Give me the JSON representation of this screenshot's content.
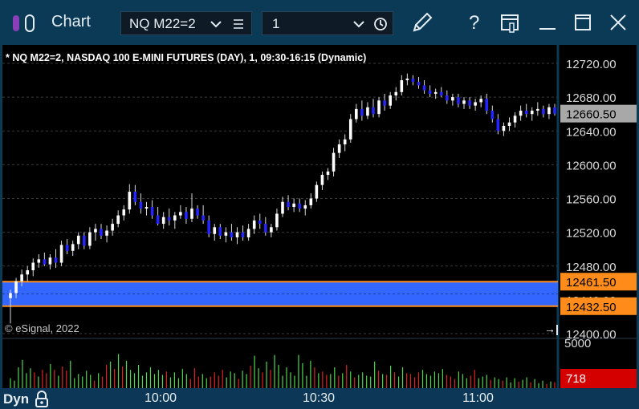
{
  "window": {
    "title": "Chart",
    "symbol": "NQ M22=2",
    "interval": "1"
  },
  "chart_data": {
    "type": "candlestick",
    "title": "* NQ M22=2, NASDAQ 100 E-MINI FUTURES (DAY), 1, 09:30-16:15 (Dynamic)",
    "watermark": "© eSignal, 2022",
    "price_axis": {
      "ticks": [
        12720.0,
        12680.0,
        12640.0,
        12600.0,
        12560.0,
        12520.0,
        12480.0,
        12440.0,
        12400.0
      ],
      "tick_labels": [
        "12720.00",
        "12680.00",
        "12640.00",
        "12600.00",
        "12560.00",
        "12520.00",
        "12480.00",
        "12440.00",
        "12400.00"
      ],
      "range": [
        12400,
        12730
      ]
    },
    "time_axis": {
      "labels": [
        "10:00",
        "10:30",
        "11:00"
      ]
    },
    "last_price": {
      "value": 12660.5,
      "label": "12660.50"
    },
    "zone": {
      "top": 12461.5,
      "top_label": "12461.50",
      "bottom": 12432.5,
      "bottom_label": "12432.50",
      "color": "#3366ff",
      "border_color": "#ff8c1a"
    },
    "volume": {
      "tick_label": "5000",
      "last_value": 718,
      "last_label": "718",
      "max": 5600,
      "values": [
        1200,
        900,
        2500,
        3400,
        1800,
        2400,
        1900,
        1400,
        2200,
        1800,
        2900,
        2200,
        1500,
        2600,
        2100,
        3300,
        1200,
        1700,
        1400,
        2100,
        1600,
        900,
        1800,
        1400,
        2800,
        3200,
        2300,
        4100,
        2600,
        3300,
        2200,
        1800,
        2800,
        1500,
        1900,
        2500,
        1700,
        2200,
        1600,
        2000,
        1300,
        1900,
        1200,
        2300,
        1700,
        1100,
        2400,
        1400,
        1700,
        1200,
        1400,
        1900,
        1500,
        2200,
        1300,
        2000,
        1800,
        1100,
        2100,
        1700,
        2700,
        3900,
        2400,
        1900,
        3200,
        2200,
        4000,
        2800,
        1500,
        2500,
        1900,
        1500,
        4000,
        3000,
        1500,
        3300,
        2500,
        1800,
        2000,
        1600,
        1700,
        2500,
        1500,
        1800,
        2800,
        2000,
        1300,
        1600,
        1900,
        1500,
        1400,
        3200,
        2100,
        1700,
        1600,
        2700,
        1900,
        1400,
        2500,
        1800,
        1700,
        1300,
        1900,
        2200,
        1700,
        1500,
        2000,
        1800,
        2300,
        1600,
        1400,
        1100,
        2000,
        1700,
        1200,
        1500,
        2200,
        1200,
        1400,
        1600,
        1000,
        1300,
        1100,
        900,
        1300,
        700,
        1200,
        800,
        1000,
        1300,
        700,
        1100,
        600,
        900,
        500,
        800,
        718
      ],
      "colors_note": "green=up, red=down"
    },
    "candles": [
      [
        12442,
        12452,
        12412,
        12448
      ],
      [
        12448,
        12466,
        12442,
        12462
      ],
      [
        12462,
        12476,
        12456,
        12470
      ],
      [
        12470,
        12480,
        12462,
        12475
      ],
      [
        12475,
        12489,
        12468,
        12484
      ],
      [
        12484,
        12494,
        12478,
        12488
      ],
      [
        12488,
        12496,
        12480,
        12482
      ],
      [
        12482,
        12494,
        12476,
        12490
      ],
      [
        12490,
        12500,
        12478,
        12484
      ],
      [
        12484,
        12510,
        12480,
        12505
      ],
      [
        12505,
        12512,
        12494,
        12498
      ],
      [
        12498,
        12510,
        12492,
        12506
      ],
      [
        12506,
        12520,
        12500,
        12516
      ],
      [
        12516,
        12520,
        12500,
        12504
      ],
      [
        12504,
        12526,
        12500,
        12520
      ],
      [
        12520,
        12530,
        12510,
        12524
      ],
      [
        12524,
        12530,
        12512,
        12516
      ],
      [
        12516,
        12528,
        12508,
        12522
      ],
      [
        12522,
        12536,
        12516,
        12530
      ],
      [
        12530,
        12546,
        12526,
        12540
      ],
      [
        12540,
        12552,
        12534,
        12547
      ],
      [
        12547,
        12577,
        12542,
        12568
      ],
      [
        12568,
        12576,
        12552,
        12556
      ],
      [
        12556,
        12566,
        12542,
        12548
      ],
      [
        12548,
        12556,
        12540,
        12550
      ],
      [
        12550,
        12558,
        12536,
        12540
      ],
      [
        12540,
        12550,
        12528,
        12530
      ],
      [
        12530,
        12544,
        12524,
        12538
      ],
      [
        12538,
        12548,
        12528,
        12534
      ],
      [
        12534,
        12544,
        12524,
        12540
      ],
      [
        12540,
        12552,
        12536,
        12544
      ],
      [
        12544,
        12550,
        12530,
        12536
      ],
      [
        12536,
        12566,
        12532,
        12548
      ],
      [
        12548,
        12552,
        12536,
        12540
      ],
      [
        12540,
        12552,
        12530,
        12534
      ],
      [
        12534,
        12540,
        12514,
        12518
      ],
      [
        12518,
        12530,
        12510,
        12526
      ],
      [
        12526,
        12530,
        12512,
        12516
      ],
      [
        12516,
        12526,
        12508,
        12520
      ],
      [
        12520,
        12530,
        12510,
        12514
      ],
      [
        12514,
        12526,
        12506,
        12520
      ],
      [
        12520,
        12528,
        12510,
        12514
      ],
      [
        12514,
        12530,
        12510,
        12524
      ],
      [
        12524,
        12540,
        12518,
        12534
      ],
      [
        12534,
        12542,
        12524,
        12530
      ],
      [
        12530,
        12538,
        12516,
        12520
      ],
      [
        12520,
        12530,
        12514,
        12526
      ],
      [
        12526,
        12548,
        12522,
        12542
      ],
      [
        12542,
        12562,
        12538,
        12556
      ],
      [
        12556,
        12564,
        12546,
        12550
      ],
      [
        12550,
        12560,
        12544,
        12554
      ],
      [
        12554,
        12560,
        12544,
        12548
      ],
      [
        12548,
        12558,
        12540,
        12552
      ],
      [
        12552,
        12566,
        12548,
        12560
      ],
      [
        12560,
        12580,
        12556,
        12576
      ],
      [
        12576,
        12592,
        12570,
        12588
      ],
      [
        12588,
        12596,
        12582,
        12592
      ],
      [
        12592,
        12620,
        12586,
        12614
      ],
      [
        12614,
        12630,
        12608,
        12624
      ],
      [
        12624,
        12636,
        12616,
        12630
      ],
      [
        12630,
        12660,
        12626,
        12654
      ],
      [
        12654,
        12672,
        12650,
        12666
      ],
      [
        12666,
        12676,
        12652,
        12658
      ],
      [
        12658,
        12674,
        12654,
        12668
      ],
      [
        12668,
        12678,
        12656,
        12660
      ],
      [
        12660,
        12680,
        12656,
        12676
      ],
      [
        12676,
        12684,
        12664,
        12670
      ],
      [
        12670,
        12686,
        12666,
        12682
      ],
      [
        12682,
        12692,
        12676,
        12686
      ],
      [
        12686,
        12706,
        12682,
        12700
      ],
      [
        12700,
        12708,
        12694,
        12702
      ],
      [
        12702,
        12706,
        12694,
        12698
      ],
      [
        12698,
        12704,
        12690,
        12694
      ],
      [
        12694,
        12700,
        12684,
        12688
      ],
      [
        12688,
        12694,
        12680,
        12684
      ],
      [
        12684,
        12690,
        12678,
        12686
      ],
      [
        12686,
        12692,
        12680,
        12682
      ],
      [
        12682,
        12688,
        12672,
        12676
      ],
      [
        12676,
        12684,
        12670,
        12680
      ],
      [
        12680,
        12684,
        12668,
        12672
      ],
      [
        12672,
        12680,
        12666,
        12676
      ],
      [
        12676,
        12680,
        12666,
        12670
      ],
      [
        12670,
        12678,
        12664,
        12674
      ],
      [
        12674,
        12682,
        12668,
        12678
      ],
      [
        12678,
        12684,
        12660,
        12664
      ],
      [
        12664,
        12670,
        12650,
        12654
      ],
      [
        12654,
        12660,
        12636,
        12640
      ],
      [
        12640,
        12650,
        12634,
        12646
      ],
      [
        12646,
        12656,
        12640,
        12650
      ],
      [
        12650,
        12662,
        12644,
        12658
      ],
      [
        12658,
        12670,
        12652,
        12664
      ],
      [
        12664,
        12672,
        12656,
        12660
      ],
      [
        12660,
        12668,
        12652,
        12664
      ],
      [
        12664,
        12674,
        12658,
        12666
      ],
      [
        12666,
        12670,
        12656,
        12660
      ],
      [
        12660,
        12672,
        12654,
        12668
      ],
      [
        12668,
        12672,
        12658,
        12660.5
      ]
    ]
  }
}
